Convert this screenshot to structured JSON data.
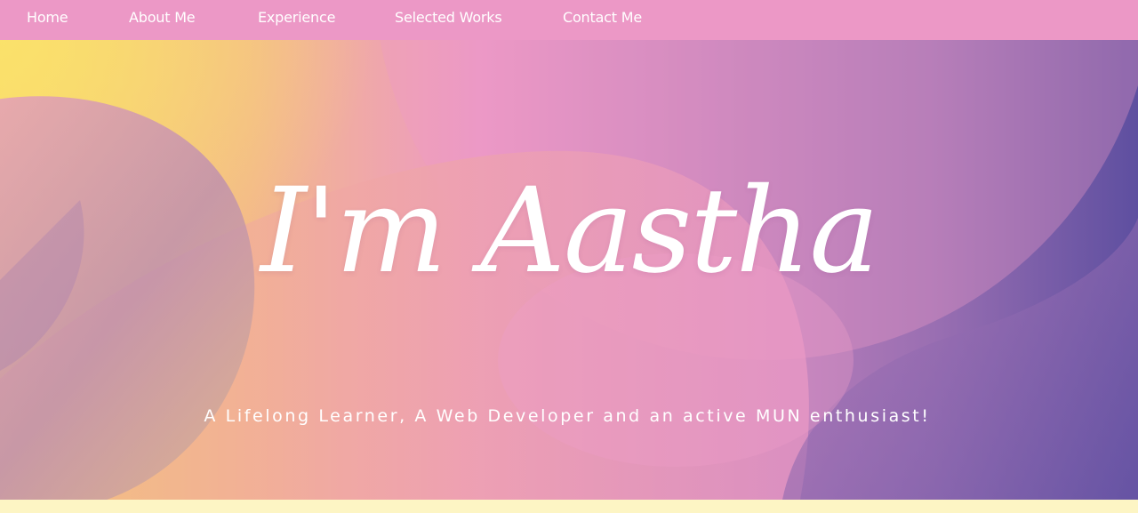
{
  "nav": {
    "items": [
      {
        "label": "Home"
      },
      {
        "label": "About Me"
      },
      {
        "label": "Experience"
      },
      {
        "label": "Selected Works"
      },
      {
        "label": "Contact Me"
      }
    ]
  },
  "hero": {
    "title": "I'm Aastha",
    "subtitle": "A Lifelong Learner, A Web Developer and an active MUN enthusiast!"
  },
  "colors": {
    "navbar": "#ec98c6",
    "gradient_start": "#f6d56f",
    "gradient_mid": "#ec98c6",
    "gradient_end": "#5e4fa0",
    "text": "#ffffff",
    "bottom_strip": "#fdf5c4"
  }
}
